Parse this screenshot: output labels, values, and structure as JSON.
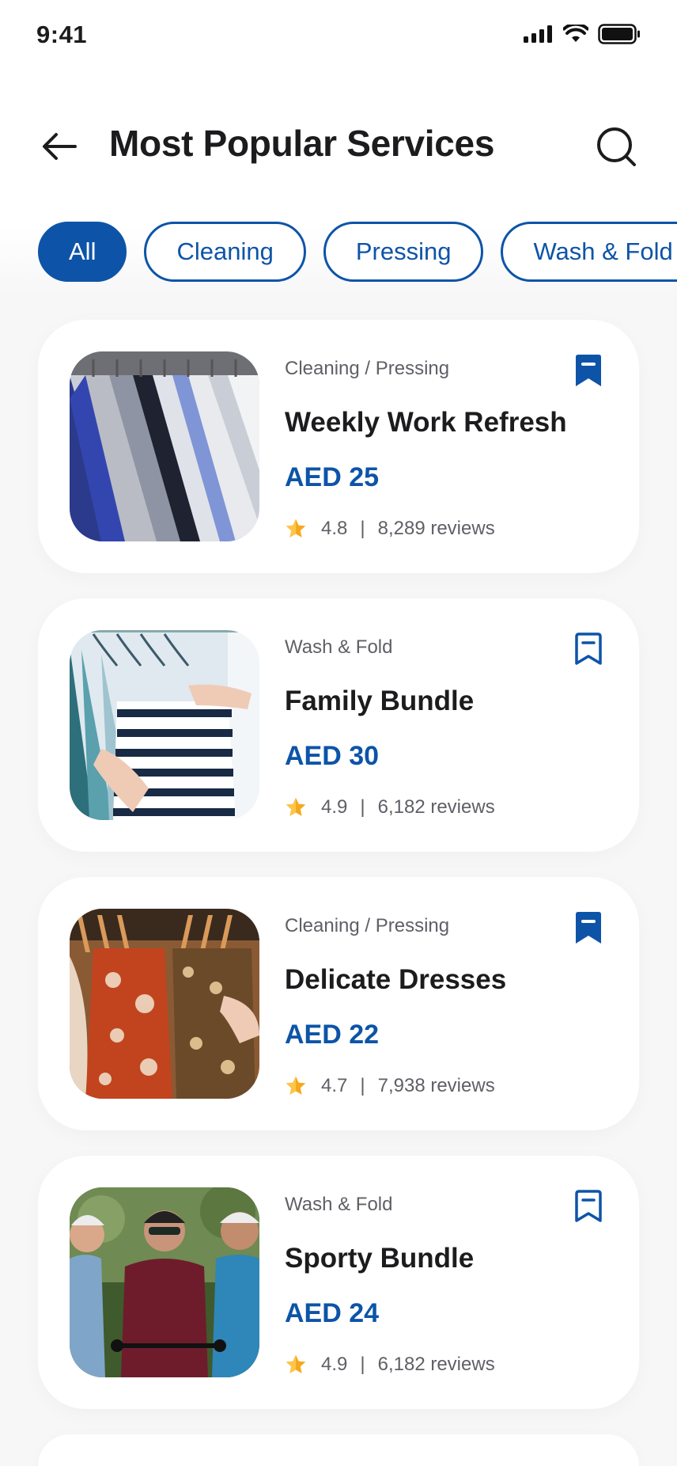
{
  "status_bar": {
    "time": "9:41"
  },
  "header": {
    "title": "Most Popular Services"
  },
  "filters": [
    "All",
    "Cleaning",
    "Pressing",
    "Wash & Fold"
  ],
  "colors": {
    "accent": "#0d54a8",
    "star": "#f6a81c",
    "text": "#1c1c1e",
    "muted": "#5f5f66"
  },
  "services": [
    {
      "category": "Cleaning / Pressing",
      "title": "Weekly Work Refresh",
      "price": "AED 25",
      "rating": "4.8",
      "separator": "|",
      "reviews": "8,289 reviews",
      "bookmarked": true,
      "image_icon": "shirts-on-hangers-photo"
    },
    {
      "category": "Wash & Fold",
      "title": "Family Bundle",
      "price": "AED 30",
      "rating": "4.9",
      "separator": "|",
      "reviews": "6,182 reviews",
      "bookmarked": false,
      "image_icon": "striped-shirts-rack-photo"
    },
    {
      "category": "Cleaning / Pressing",
      "title": "Delicate Dresses",
      "price": "AED 22",
      "rating": "4.7",
      "separator": "|",
      "reviews": "7,938 reviews",
      "bookmarked": true,
      "image_icon": "dresses-rack-photo"
    },
    {
      "category": "Wash & Fold",
      "title": "Sporty Bundle",
      "price": "AED 24",
      "rating": "4.9",
      "separator": "|",
      "reviews": "6,182 reviews",
      "bookmarked": false,
      "image_icon": "cyclists-photo"
    }
  ]
}
